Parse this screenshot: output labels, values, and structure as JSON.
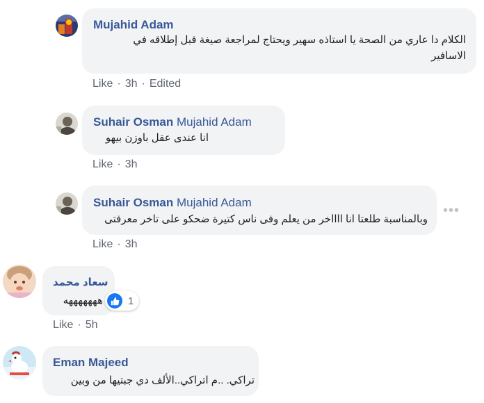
{
  "comments": [
    {
      "author": "Mujahid Adam",
      "text_line1": "الكلام دا عاري من الصحة يا استاذه سهير ويحتاج لمراجعة صيغة قبل إطلاقه في",
      "text_line2": "الاسافير",
      "like": "Like",
      "time": "3h",
      "edited": "Edited"
    },
    {
      "author": "Suhair Osman",
      "reply_to": "Mujahid Adam",
      "text": "انا عندى عقل باوزن بيهو",
      "like": "Like",
      "time": "3h"
    },
    {
      "author": "Suhair Osman",
      "reply_to": "Mujahid Adam",
      "text": "وبالمناسبة طلعتا انا ااااخر من يعلم وفى ناس كتيرة ضحكو على تاخر معرفتى",
      "like": "Like",
      "time": "3h",
      "more": "•••"
    },
    {
      "author": "سعاد محمد",
      "text": "هههههههه",
      "reaction_count": "1",
      "like": "Like",
      "time": "5h"
    },
    {
      "author": "Eman Majeed",
      "text": "تراكي. ..م اتراكي..الألف دي جبتيها من وبين"
    }
  ],
  "separator": "·",
  "colors": {
    "author": "#385898",
    "bubble": "#f2f3f5",
    "meta": "#606770",
    "like_reaction": "#1877f2"
  }
}
